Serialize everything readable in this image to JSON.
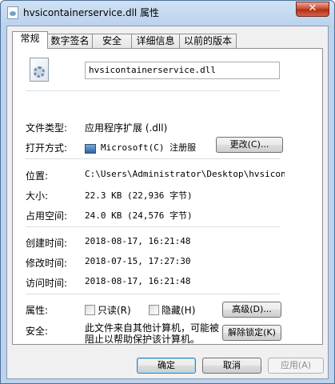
{
  "window": {
    "title": "hvsicontainerservice.dll 属性",
    "close_label": "✕"
  },
  "tabs": [
    {
      "label": "常规",
      "active": true
    },
    {
      "label": "数字签名",
      "active": false
    },
    {
      "label": "安全",
      "active": false
    },
    {
      "label": "详细信息",
      "active": false
    },
    {
      "label": "以前的版本",
      "active": false
    }
  ],
  "general": {
    "file_name": "hvsicontainerservice.dll",
    "file_type_label": "文件类型:",
    "file_type_value": "应用程序扩展 (.dll)",
    "opens_with_label": "打开方式:",
    "opens_with_value": "Microsoft(C) 注册服",
    "change_button": "更改(C)...",
    "location_label": "位置:",
    "location_value": "C:\\Users\\Administrator\\Desktop\\hvsicontai",
    "size_label": "大小:",
    "size_value": "22.3 KB (22,936 字节)",
    "size_on_disk_label": "占用空间:",
    "size_on_disk_value": "24.0 KB (24,576 字节)",
    "created_label": "创建时间:",
    "created_value": "2018-08-17, 16:21:48",
    "modified_label": "修改时间:",
    "modified_value": "2018-07-15, 17:27:30",
    "accessed_label": "访问时间:",
    "accessed_value": "2018-08-17, 16:21:48",
    "attributes_label": "属性:",
    "readonly_label": "只读(R)",
    "hidden_label": "隐藏(H)",
    "advanced_button": "高级(D)...",
    "security_label": "安全:",
    "security_text": "此文件来自其他计算机，可能被阻止以帮助保护该计算机。",
    "unblock_button": "解除锁定(K)"
  },
  "footer": {
    "ok_button": "确定",
    "cancel_button": "取消",
    "apply_button": "应用(A)"
  }
}
